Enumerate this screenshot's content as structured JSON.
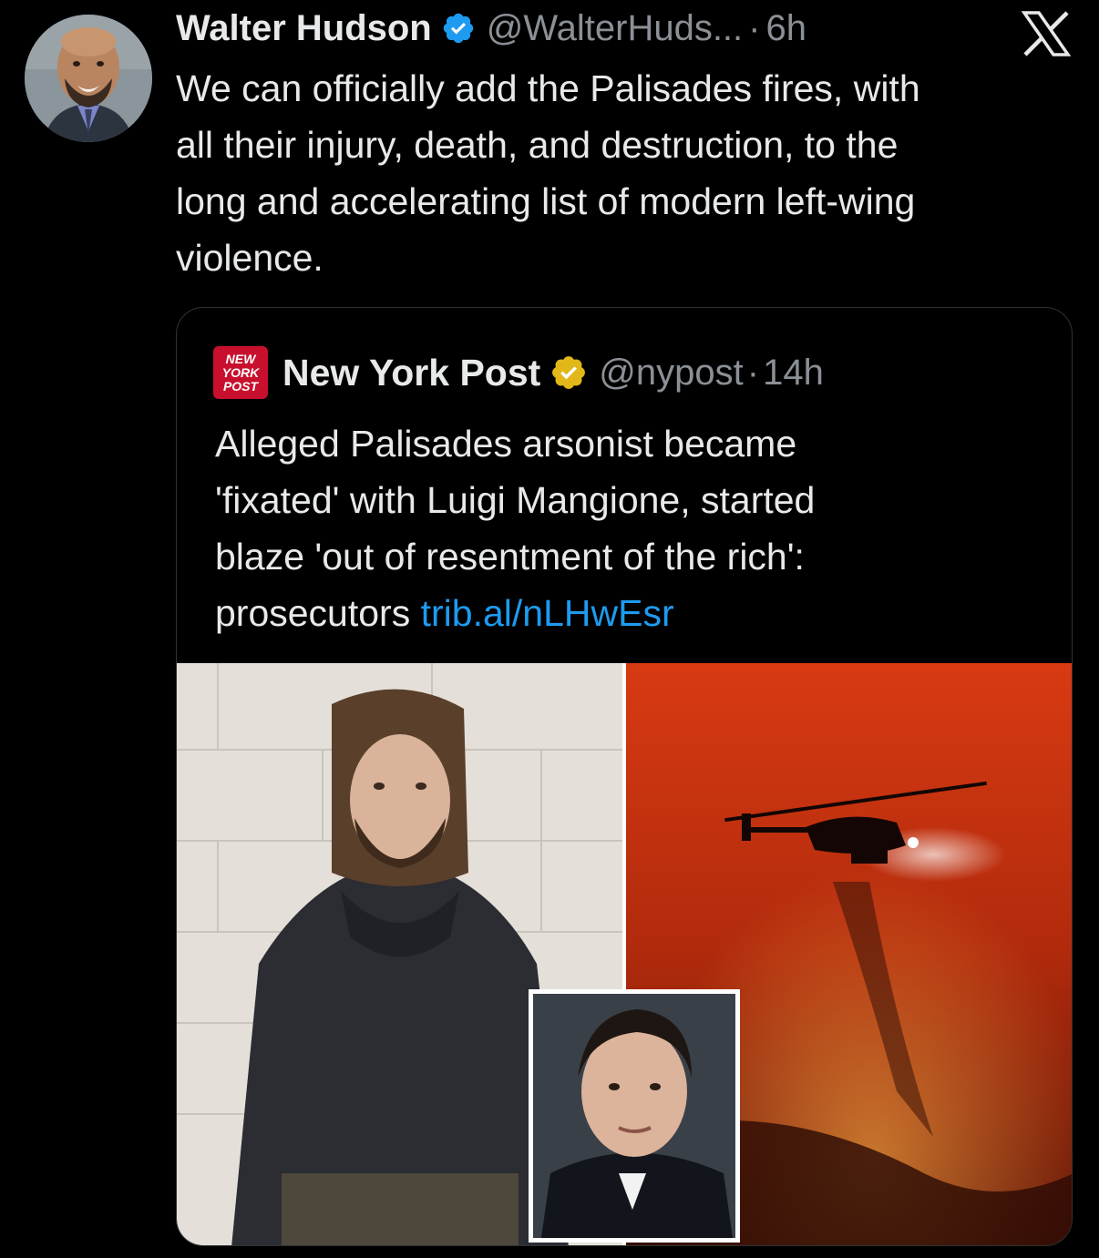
{
  "author": {
    "name": "Walter Hudson",
    "handle": "@WalterHuds...",
    "separator": "·",
    "time": "6h"
  },
  "tweet": {
    "lines": [
      "We can officially add the Palisades fires, with",
      "all their injury, death, and destruction, to the",
      "long and accelerating list of modern left-wing",
      "violence."
    ]
  },
  "quoted": {
    "name": "New York Post",
    "handle": "@nypost",
    "separator": "·",
    "time": "14h",
    "logo_text": [
      "NEW",
      "YORK",
      "POST"
    ],
    "lines": [
      "Alleged Palisades arsonist became",
      "'fixated' with Luigi Mangione, started",
      "blaze 'out of resentment of the rich':",
      "prosecutors"
    ],
    "link": "trib.al/nLHwEsr"
  },
  "icons": {
    "verified": "verified-badge-blue",
    "gold": "verified-badge-gold",
    "platform": "x-logo"
  },
  "colors": {
    "background": "#000000",
    "text": "#e7e9ea",
    "muted": "#8b9096",
    "link": "#1d9bf0",
    "verified_blue": "#1d9bf0",
    "verified_gold": "#e2b719",
    "nyp_red": "#c8102e"
  }
}
